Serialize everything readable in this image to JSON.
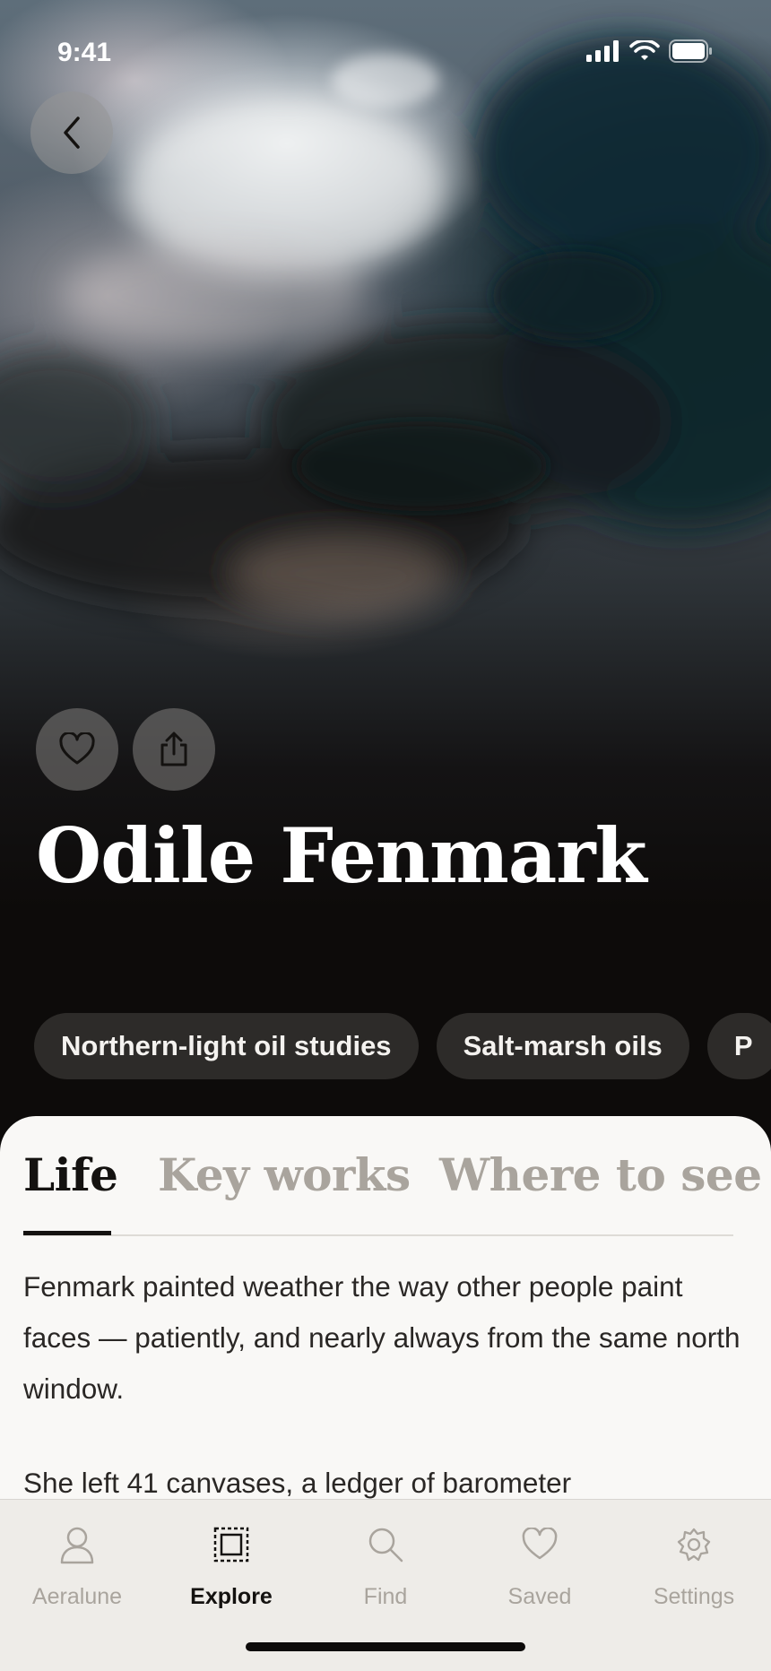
{
  "status_bar": {
    "time": "9:41"
  },
  "artist": {
    "name": "Odile Fenmark"
  },
  "chips": [
    "Northern-light oil studies",
    "Salt-marsh oils",
    "P"
  ],
  "tabs": [
    {
      "label": "Life",
      "active": true
    },
    {
      "label": "Key works",
      "active": false
    },
    {
      "label": "Where to see",
      "active": false
    }
  ],
  "body": {
    "paragraph1": "Fenmark painted weather the way other people paint faces — patiently, and nearly always from the same north window.",
    "paragraph2": "She left 41 canvases, a ledger of barometer"
  },
  "tab_bar": [
    {
      "label": "Aeralune",
      "icon": "person-icon",
      "active": false
    },
    {
      "label": "Explore",
      "icon": "frame-icon",
      "active": true
    },
    {
      "label": "Find",
      "icon": "search-icon",
      "active": false
    },
    {
      "label": "Saved",
      "icon": "heart-icon",
      "active": false
    },
    {
      "label": "Settings",
      "icon": "gear-icon",
      "active": false
    }
  ],
  "colors": {
    "accent": "#141210",
    "inactive": "#a9a49d",
    "chip_bg": "#2d2b29",
    "sheet_bg": "#f9f8f6"
  }
}
